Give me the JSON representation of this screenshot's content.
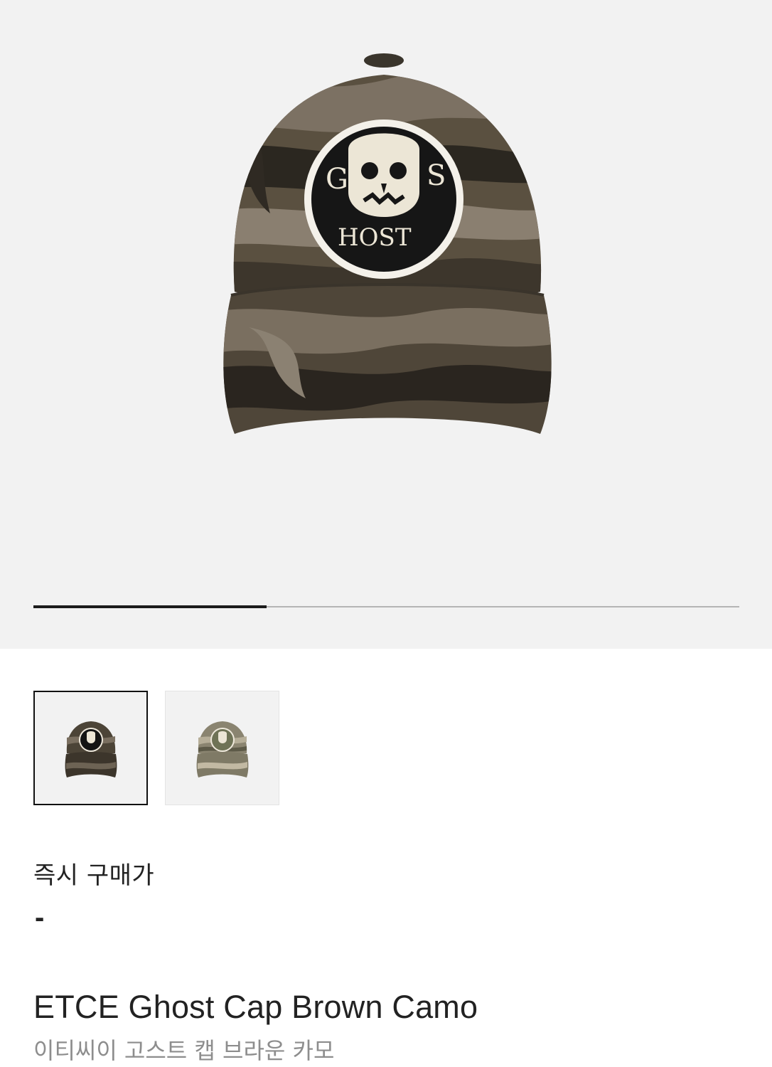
{
  "gallery": {
    "main_image_icon": "ghost-camo-cap-image",
    "progress": 0.33,
    "thumbnails": [
      {
        "icon": "brown-camo-cap-thumbnail",
        "selected": true
      },
      {
        "icon": "green-camo-cap-thumbnail",
        "selected": false
      }
    ]
  },
  "price": {
    "label": "즉시 구매가",
    "value": "-"
  },
  "product": {
    "name_en": "ETCE Ghost Cap Brown Camo",
    "name_ko": "이티씨이 고스트 캡 브라운 카모"
  },
  "colors": {
    "hero_bg": "#f2f2f2",
    "progress_fill": "#1c1c1c",
    "progress_track": "#b5b5b5",
    "subtitle": "#8d8d8d"
  }
}
